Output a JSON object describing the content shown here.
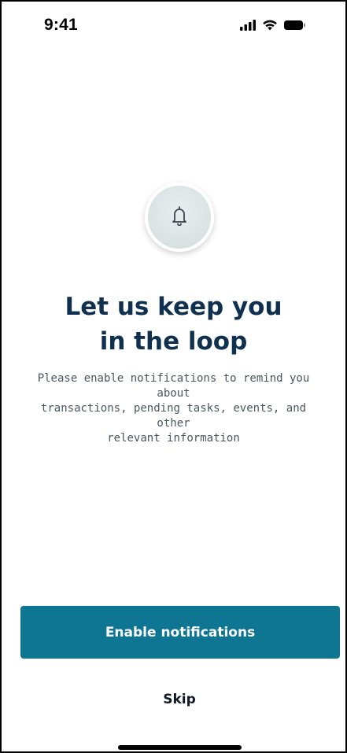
{
  "status_bar": {
    "time": "9:41",
    "icons": [
      "cellular-signal-icon",
      "wifi-icon",
      "battery-icon"
    ]
  },
  "hero": {
    "icon": "bell-icon",
    "headline_line1": "Let us keep you",
    "headline_line2": "in the loop",
    "description_line1": "Please enable notifications to remind you about",
    "description_line2": "transactions, pending tasks, events, and other",
    "description_line3": "relevant information"
  },
  "actions": {
    "enable_label": "Enable notifications",
    "skip_label": "Skip"
  },
  "colors": {
    "primary": "#0e7693",
    "headline": "#10304f",
    "body_text": "#4b5563"
  }
}
